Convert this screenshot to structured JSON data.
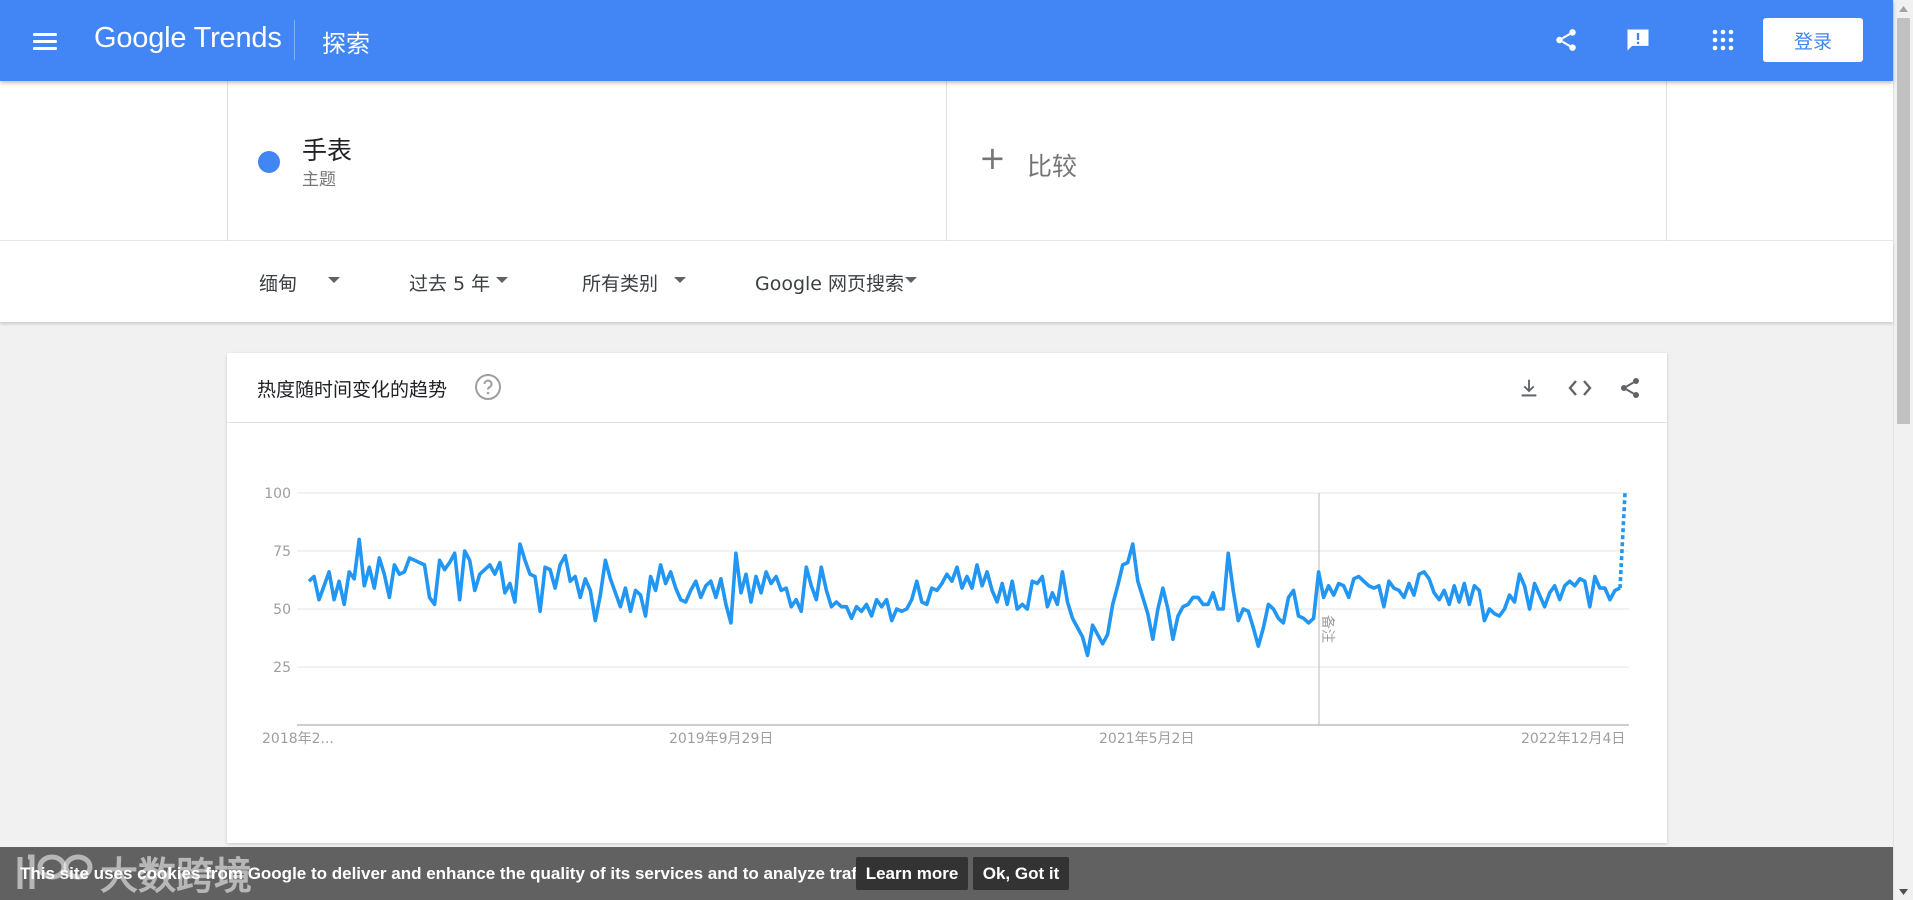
{
  "header": {
    "brand": "Google Trends",
    "page_title": "探索",
    "login_label": "登录",
    "icons": [
      "menu-icon",
      "share-icon",
      "feedback-icon",
      "apps-icon"
    ]
  },
  "search": {
    "term": "手表",
    "term_type": "主题",
    "term_color": "#4285f4",
    "compare_label": "比较"
  },
  "filters": {
    "region": "缅甸",
    "time_range": "过去 5 年",
    "category": "所有类别",
    "property": "Google 网页搜索"
  },
  "card": {
    "title": "热度随时间变化的趋势",
    "icons": [
      "help-icon",
      "download-icon",
      "embed-icon",
      "share-icon"
    ],
    "note_label": "备注"
  },
  "chart_data": {
    "type": "line",
    "ylim": [
      0,
      100
    ],
    "y_ticks": [
      25,
      50,
      75,
      100
    ],
    "x_tick_labels": [
      "2018年2...",
      "2019年9月29日",
      "2021年5月2日",
      "2022年12月4日"
    ],
    "grid": true,
    "series": [
      {
        "name": "手表",
        "color": "#2196f3",
        "values": [
          62,
          64,
          54,
          60,
          66,
          54,
          62,
          52,
          66,
          63,
          80,
          60,
          68,
          59,
          72,
          65,
          55,
          69,
          65,
          66,
          72,
          71,
          70,
          69,
          55,
          52,
          71,
          67,
          70,
          74,
          54,
          75,
          71,
          58,
          65,
          67,
          69,
          65,
          70,
          57,
          61,
          53,
          78,
          71,
          65,
          64,
          49,
          68,
          67,
          59,
          69,
          73,
          62,
          64,
          55,
          63,
          58,
          45,
          56,
          71,
          63,
          57,
          51,
          59,
          49,
          58,
          56,
          47,
          64,
          58,
          69,
          61,
          66,
          59,
          54,
          53,
          58,
          62,
          55,
          60,
          62,
          55,
          63,
          52,
          44,
          74,
          57,
          65,
          53,
          64,
          57,
          66,
          61,
          64,
          58,
          59,
          51,
          54,
          49,
          68,
          60,
          54,
          68,
          58,
          51,
          53,
          51,
          51,
          46,
          51,
          49,
          52,
          47,
          54,
          51,
          54,
          45,
          50,
          49,
          50,
          54,
          62,
          53,
          52,
          59,
          58,
          61,
          65,
          62,
          68,
          59,
          64,
          59,
          69,
          60,
          66,
          58,
          53,
          61,
          52,
          62,
          50,
          52,
          50,
          62,
          61,
          64,
          51,
          57,
          52,
          66,
          53,
          46,
          42,
          38,
          30,
          43,
          39,
          35,
          39,
          52,
          60,
          69,
          70,
          78,
          62,
          55,
          48,
          37,
          50,
          59,
          50,
          37,
          47,
          51,
          52,
          55,
          55,
          52,
          52,
          57,
          50,
          50,
          74,
          58,
          45,
          50,
          49,
          42,
          34,
          42,
          52,
          50,
          46,
          44,
          55,
          58,
          47,
          46,
          44,
          46,
          66,
          55,
          60,
          56,
          61,
          60,
          55,
          63,
          64,
          62,
          60,
          59,
          60,
          51,
          62,
          59,
          58,
          55,
          61,
          56,
          65,
          66,
          63,
          57,
          54,
          58,
          52,
          60,
          53,
          61,
          52,
          60,
          58,
          45,
          50,
          48,
          47,
          50,
          56,
          53,
          65,
          60,
          50,
          61,
          56,
          51,
          57,
          60,
          54,
          60,
          62,
          60,
          63,
          62,
          51,
          64,
          59,
          59,
          54,
          58,
          59,
          100
        ]
      }
    ]
  },
  "cookie": {
    "text": "This site uses cookies from Google to deliver and enhance the quality of its services and to analyze traffic.",
    "learn_more": "Learn more",
    "ok": "Ok, Got it"
  },
  "watermark": "大数跨境"
}
